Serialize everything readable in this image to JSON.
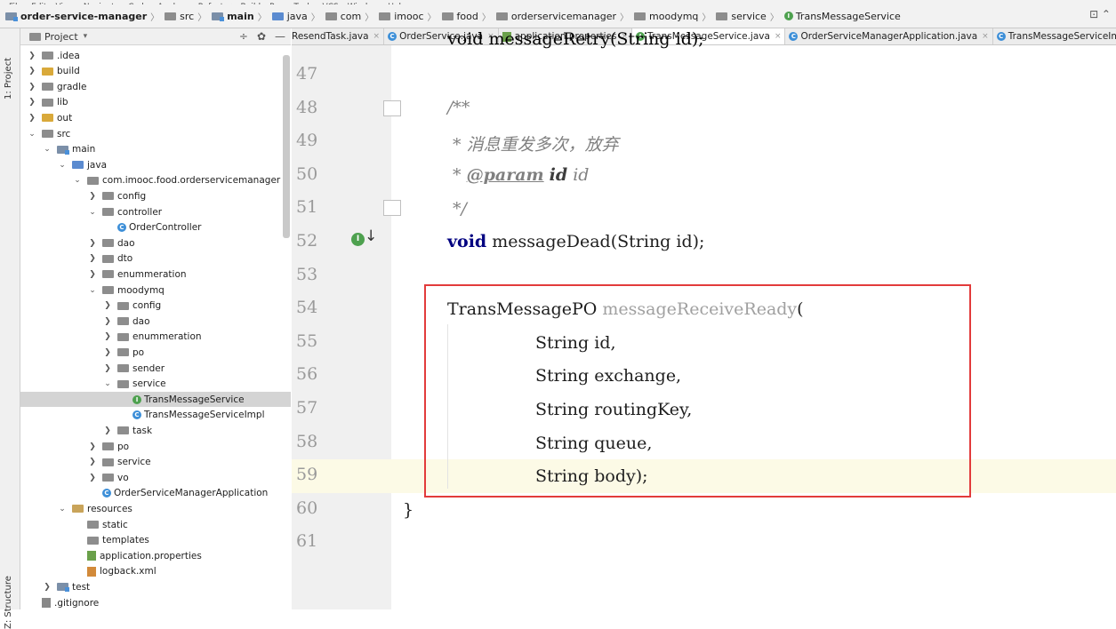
{
  "menu": [
    "File",
    "Edit",
    "View",
    "Navigate",
    "Code",
    "Analyze",
    "Refactor",
    "Build",
    "Run",
    "Tools",
    "VCS",
    "Window",
    "Help"
  ],
  "breadcrumb": [
    "order-service-manager",
    "src",
    "main",
    "java",
    "com",
    "imooc",
    "food",
    "orderservicemanager",
    "moodymq",
    "service",
    "TransMessageService"
  ],
  "left_strip": {
    "project_tab": "1: Project",
    "structure_tab": "Z: Structure"
  },
  "project_panel": {
    "title": "Project",
    "tree": [
      {
        "label": ".idea",
        "depth": 0,
        "arrow": "›",
        "icon": "folder"
      },
      {
        "label": "build",
        "depth": 0,
        "arrow": "›",
        "icon": "folder-orange"
      },
      {
        "label": "gradle",
        "depth": 0,
        "arrow": "›",
        "icon": "folder"
      },
      {
        "label": "lib",
        "depth": 0,
        "arrow": "›",
        "icon": "folder"
      },
      {
        "label": "out",
        "depth": 0,
        "arrow": "›",
        "icon": "folder-orange"
      },
      {
        "label": "src",
        "depth": 0,
        "arrow": "⌄",
        "icon": "folder"
      },
      {
        "label": "main",
        "depth": 1,
        "arrow": "⌄",
        "icon": "folder-mod"
      },
      {
        "label": "java",
        "depth": 2,
        "arrow": "⌄",
        "icon": "folder-src"
      },
      {
        "label": "com.imooc.food.orderservicemanager",
        "depth": 3,
        "arrow": "⌄",
        "icon": "folder"
      },
      {
        "label": "config",
        "depth": 4,
        "arrow": "›",
        "icon": "folder"
      },
      {
        "label": "controller",
        "depth": 4,
        "arrow": "⌄",
        "icon": "folder"
      },
      {
        "label": "OrderController",
        "depth": 5,
        "arrow": "",
        "icon": "class"
      },
      {
        "label": "dao",
        "depth": 4,
        "arrow": "›",
        "icon": "folder"
      },
      {
        "label": "dto",
        "depth": 4,
        "arrow": "›",
        "icon": "folder"
      },
      {
        "label": "enummeration",
        "depth": 4,
        "arrow": "›",
        "icon": "folder"
      },
      {
        "label": "moodymq",
        "depth": 4,
        "arrow": "⌄",
        "icon": "folder"
      },
      {
        "label": "config",
        "depth": 5,
        "arrow": "›",
        "icon": "folder"
      },
      {
        "label": "dao",
        "depth": 5,
        "arrow": "›",
        "icon": "folder"
      },
      {
        "label": "enummeration",
        "depth": 5,
        "arrow": "›",
        "icon": "folder"
      },
      {
        "label": "po",
        "depth": 5,
        "arrow": "›",
        "icon": "folder"
      },
      {
        "label": "sender",
        "depth": 5,
        "arrow": "›",
        "icon": "folder"
      },
      {
        "label": "service",
        "depth": 5,
        "arrow": "⌄",
        "icon": "folder"
      },
      {
        "label": "TransMessageService",
        "depth": 6,
        "arrow": "",
        "icon": "interface",
        "selected": true
      },
      {
        "label": "TransMessageServiceImpl",
        "depth": 6,
        "arrow": "",
        "icon": "class"
      },
      {
        "label": "task",
        "depth": 5,
        "arrow": "›",
        "icon": "folder"
      },
      {
        "label": "po",
        "depth": 4,
        "arrow": "›",
        "icon": "folder"
      },
      {
        "label": "service",
        "depth": 4,
        "arrow": "›",
        "icon": "folder"
      },
      {
        "label": "vo",
        "depth": 4,
        "arrow": "›",
        "icon": "folder"
      },
      {
        "label": "OrderServiceManagerApplication",
        "depth": 4,
        "arrow": "",
        "icon": "class"
      },
      {
        "label": "resources",
        "depth": 2,
        "arrow": "⌄",
        "icon": "folder-res"
      },
      {
        "label": "static",
        "depth": 3,
        "arrow": "",
        "icon": "folder"
      },
      {
        "label": "templates",
        "depth": 3,
        "arrow": "",
        "icon": "folder"
      },
      {
        "label": "application.properties",
        "depth": 3,
        "arrow": "",
        "icon": "props"
      },
      {
        "label": "logback.xml",
        "depth": 3,
        "arrow": "",
        "icon": "xml"
      },
      {
        "label": "test",
        "depth": 1,
        "arrow": "›",
        "icon": "folder-mod"
      },
      {
        "label": ".gitignore",
        "depth": 0,
        "arrow": "",
        "icon": "file"
      }
    ]
  },
  "tabs": [
    {
      "label": "ResendTask.java",
      "icon": ""
    },
    {
      "label": "OrderService.java",
      "icon": "class"
    },
    {
      "label": "application.properties",
      "icon": "props"
    },
    {
      "label": "TransMessageService.java",
      "icon": "interface",
      "active": true
    },
    {
      "label": "OrderServiceManagerApplication.java",
      "icon": "class"
    },
    {
      "label": "TransMessageServiceImpl.java",
      "icon": "class"
    }
  ],
  "editor": {
    "line_numbers": [
      "47",
      "48",
      "49",
      "50",
      "51",
      "52",
      "53",
      "54",
      "55",
      "56",
      "57",
      "58",
      "59",
      "60",
      "61"
    ],
    "top_partial": "void messageRetry(String id);",
    "lines": {
      "l48": "/**",
      "l49": " * 消息重发多次，放弃",
      "l50_star": " * ",
      "l50_tag": "@param",
      "l50_name": "id",
      "l50_desc": "id",
      "l51": " */",
      "l52_kw": "void",
      "l52_rest": " messageDead(String id);",
      "l54_type": "TransMessagePO ",
      "l54_name": "messageReceiveReady",
      "l54_paren": "(",
      "l55": "String id,",
      "l56": "String exchange,",
      "l57": "String routingKey,",
      "l58": "String queue,",
      "l59": "String body);",
      "l60": "}"
    },
    "gutter_icon": "implemented-interface-icon"
  }
}
